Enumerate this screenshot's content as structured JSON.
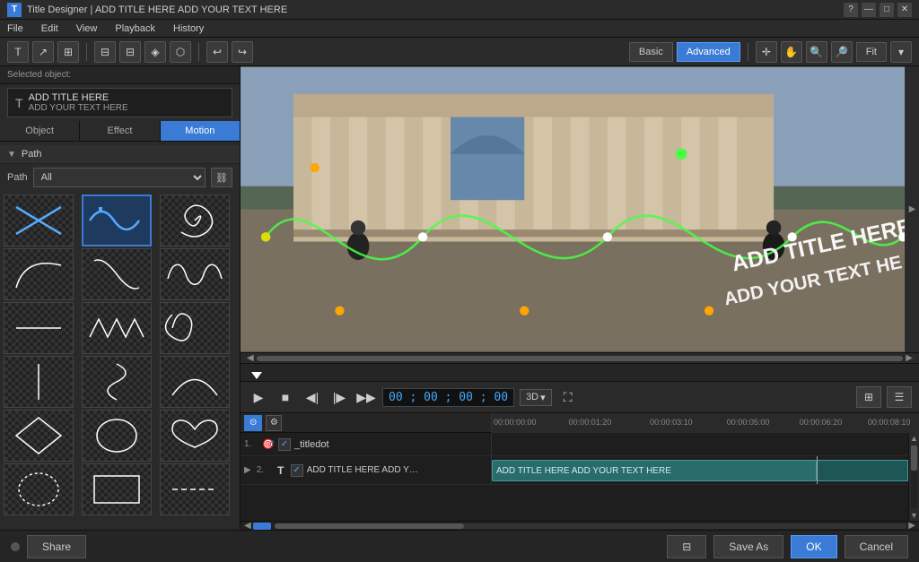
{
  "titlebar": {
    "icon": "T",
    "title": "Title Designer | ADD TITLE HERE  ADD YOUR TEXT HERE",
    "help_label": "?",
    "minimize_label": "—",
    "maximize_label": "□",
    "close_label": "✕"
  },
  "menubar": {
    "items": [
      "File",
      "Edit",
      "View",
      "Playback",
      "History"
    ]
  },
  "toolbar": {
    "mode_basic": "Basic",
    "mode_advanced": "Advanced",
    "fit_label": "Fit"
  },
  "left_panel": {
    "selected_object_label": "Selected object:",
    "preview_title": "ADD TITLE HERE",
    "preview_subtitle": "ADD YOUR TEXT HERE",
    "tabs": [
      "Object",
      "Effect",
      "Motion"
    ],
    "active_tab": "Motion",
    "path_section": "Path",
    "path_label": "Path",
    "path_value": "All",
    "patterns": [
      {
        "id": "x-cross",
        "label": "X cross"
      },
      {
        "id": "wave",
        "label": "Wave",
        "selected": true
      },
      {
        "id": "spiral",
        "label": "Spiral"
      },
      {
        "id": "curve1",
        "label": "Curve 1"
      },
      {
        "id": "s-curve",
        "label": "S Curve"
      },
      {
        "id": "wave2",
        "label": "Wave 2"
      },
      {
        "id": "straight",
        "label": "Straight"
      },
      {
        "id": "sharp-wave",
        "label": "Sharp Wave"
      },
      {
        "id": "loop",
        "label": "Loop"
      },
      {
        "id": "zigzag",
        "label": "Zigzag"
      },
      {
        "id": "spiral2",
        "label": "Spiral 2"
      },
      {
        "id": "arc",
        "label": "Arc"
      },
      {
        "id": "diamond",
        "label": "Diamond"
      },
      {
        "id": "circle",
        "label": "Circle"
      },
      {
        "id": "heart",
        "label": "Heart"
      },
      {
        "id": "circle2",
        "label": "Circle 2"
      },
      {
        "id": "rect",
        "label": "Rectangle"
      },
      {
        "id": "dashed",
        "label": "Dashed line"
      }
    ]
  },
  "preview": {
    "overlay_text_line1": "ADD TITLE HERE",
    "overlay_text_line2": "ADD YOUR TEXT HE",
    "timecode": "00 ; 00 ; 00 ; 00"
  },
  "transport": {
    "play_label": "▶",
    "stop_label": "■",
    "prev_label": "◀|",
    "next_frame_label": "|▶",
    "fast_forward_label": "▶▶",
    "timecode": "00 ; 00 ; 00 ; 00",
    "mode_3d": "3D"
  },
  "timeline": {
    "header_button": "⊙",
    "ruler_marks": [
      {
        "label": "00:00:00:00",
        "pos_pct": 0
      },
      {
        "label": "00:00:01:20",
        "pos_pct": 20
      },
      {
        "label": "00:00:03:10",
        "pos_pct": 40
      },
      {
        "label": "00:00:05:00",
        "pos_pct": 60
      },
      {
        "label": "00:00:06:20",
        "pos_pct": 78
      },
      {
        "label": "00:00:08:10",
        "pos_pct": 95
      }
    ],
    "rows": [
      {
        "num": "1.",
        "icon": "🎯",
        "checked": true,
        "name": "_titledot",
        "has_expand": false,
        "clip": null
      },
      {
        "num": "2.",
        "icon": "T",
        "checked": true,
        "name": "ADD TITLE HERE ADD YOUR TEXT HERE",
        "has_expand": true,
        "clip": {
          "text": "ADD TITLE HERE  ADD YOUR TEXT HERE",
          "start_pct": 0,
          "width_pct": 78
        }
      }
    ]
  },
  "bottom": {
    "share_label": "Share",
    "save_as_label": "Save As",
    "ok_label": "OK",
    "cancel_label": "Cancel"
  }
}
